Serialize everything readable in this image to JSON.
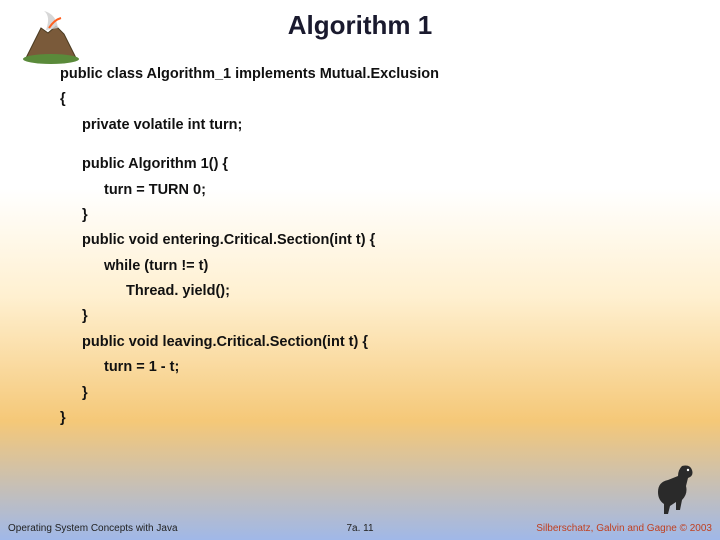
{
  "title": "Algorithm 1",
  "code": {
    "l1": "public class Algorithm_1 implements Mutual.Exclusion",
    "l2": "{",
    "l3": "private volatile int turn;",
    "l4": "public Algorithm 1() {",
    "l5": "turn = TURN 0;",
    "l6": "}",
    "l7": "public void entering.Critical.Section(int t) {",
    "l8": "while (turn != t)",
    "l9": "Thread. yield();",
    "l10": "}",
    "l11": "public void leaving.Critical.Section(int t) {",
    "l12": "turn = 1 - t;",
    "l13": "}",
    "l14": "}"
  },
  "footer": {
    "left": "Operating System Concepts with Java",
    "center": "7a. 11",
    "right": "Silberschatz, Galvin and Gagne © 2003"
  },
  "icons": {
    "volcano": "volcano-icon",
    "dino": "dinosaur-icon"
  }
}
